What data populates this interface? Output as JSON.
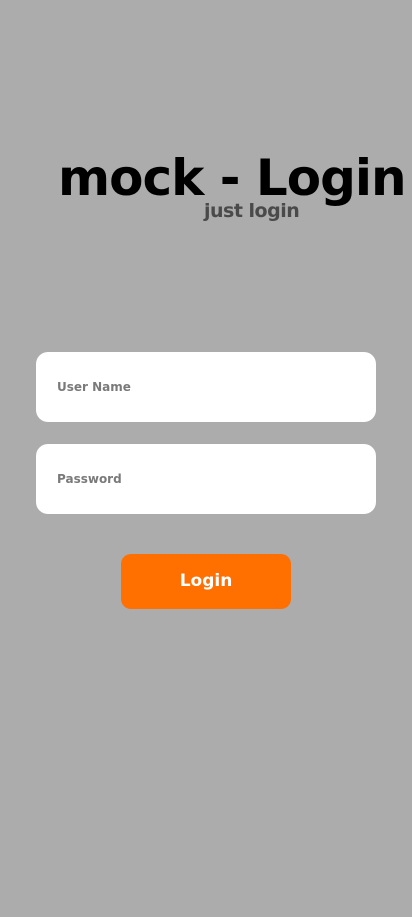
{
  "app": {
    "title": "mock - Login",
    "subtitle": "just login"
  },
  "form": {
    "username": {
      "value": "",
      "placeholder": "User Name"
    },
    "password": {
      "value": "",
      "placeholder": "Password"
    },
    "login_label": "Login"
  },
  "colors": {
    "background": "#acacac",
    "field_background": "#ffffff",
    "accent": "#ff7000",
    "title_text": "#000000",
    "subtitle_text": "#4a4a4a"
  }
}
